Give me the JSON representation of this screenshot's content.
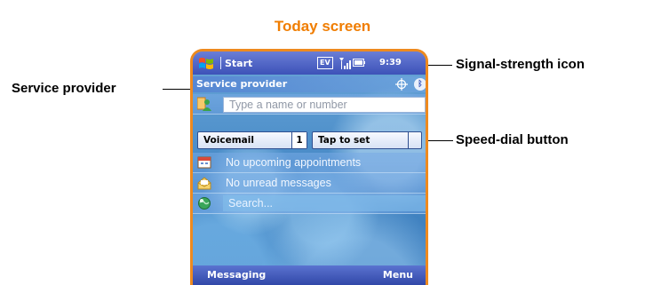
{
  "title": "Today screen",
  "callouts": {
    "signal": "Signal-strength icon",
    "provider": "Service provider",
    "speed_dial": "Speed-dial button"
  },
  "device": {
    "title_bar": {
      "start_label": "Start",
      "ev_badge": "EV",
      "time": "9:39"
    },
    "provider_row": {
      "name": "Service provider"
    },
    "dial_row": {
      "placeholder": "Type a name or number"
    },
    "speed_dial": [
      {
        "label": "Voicemail",
        "number": "1"
      },
      {
        "label": "Tap to set",
        "number": ""
      }
    ],
    "calendar_row": {
      "text": "No upcoming appointments"
    },
    "messages_row": {
      "text": "No unread messages"
    },
    "search_row": {
      "text": "Search..."
    },
    "softkeys": {
      "left": "Messaging",
      "right": "Menu"
    }
  },
  "colors": {
    "title_accent": "#f07d00",
    "device_border": "#ee8a1f",
    "titlebar_blue": "#3d52b8"
  },
  "icons": {
    "start": "windows-flag-icon",
    "signal": "signal-strength-icon",
    "battery": "battery-icon",
    "gps": "target-icon",
    "bluetooth": "bluetooth-icon",
    "contacts": "contacts-icon",
    "calendar": "calendar-icon",
    "messages": "envelope-icon",
    "search": "search-globe-icon"
  }
}
